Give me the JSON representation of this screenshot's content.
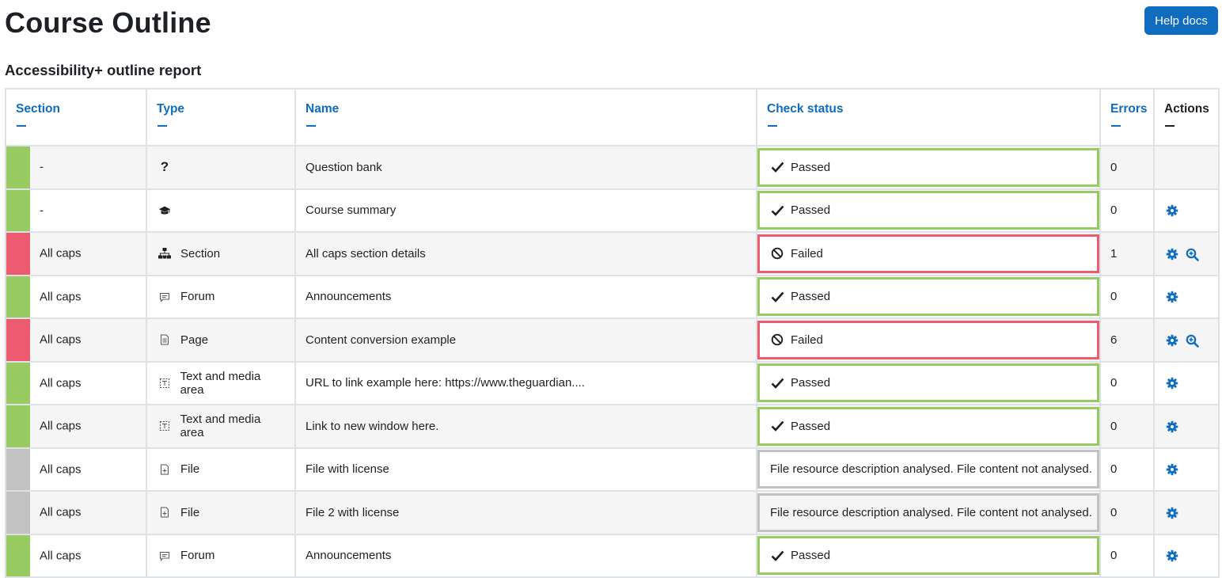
{
  "page": {
    "title": "Course Outline",
    "help_label": "Help docs"
  },
  "report": {
    "title": "Accessibility+ outline report"
  },
  "colors": {
    "accent": "#0f6cbf",
    "pass": "#98ca62",
    "fail": "#ec5b6f",
    "neutral": "#c2c2c2"
  },
  "table": {
    "headers": [
      "Section",
      "Type",
      "Name",
      "Check status",
      "Errors",
      "Actions"
    ],
    "rows": [
      {
        "status_kind": "pass",
        "section": "-",
        "type": "",
        "type_icon": "question-icon",
        "name": "Question bank",
        "status": "Passed",
        "errors": "0",
        "actions": []
      },
      {
        "status_kind": "pass",
        "section": "-",
        "type": "",
        "type_icon": "graduation-cap-icon",
        "name": "Course summary",
        "status": "Passed",
        "errors": "0",
        "actions": [
          "gear-icon"
        ]
      },
      {
        "status_kind": "fail",
        "section": "All caps",
        "type": "Section",
        "type_icon": "sitemap-icon",
        "name": "All caps section details",
        "status": "Failed",
        "errors": "1",
        "actions": [
          "gear-icon",
          "zoom-icon"
        ]
      },
      {
        "status_kind": "pass",
        "section": "All caps",
        "type": "Forum",
        "type_icon": "forum-icon",
        "name": "Announcements",
        "status": "Passed",
        "errors": "0",
        "actions": [
          "gear-icon"
        ]
      },
      {
        "status_kind": "fail",
        "section": "All caps",
        "type": "Page",
        "type_icon": "page-icon",
        "name": "Content conversion example",
        "status": "Failed",
        "errors": "6",
        "actions": [
          "gear-icon",
          "zoom-icon"
        ]
      },
      {
        "status_kind": "pass",
        "section": "All caps",
        "type": "Text and media area",
        "type_icon": "text-media-icon",
        "name": "URL to link example here: https://www.theguardian....",
        "status": "Passed",
        "errors": "0",
        "actions": [
          "gear-icon"
        ]
      },
      {
        "status_kind": "pass",
        "section": "All caps",
        "type": "Text and media area",
        "type_icon": "text-media-icon",
        "name": "Link to new window here.",
        "status": "Passed",
        "errors": "0",
        "actions": [
          "gear-icon"
        ]
      },
      {
        "status_kind": "neutral",
        "section": "All caps",
        "type": "File",
        "type_icon": "file-icon",
        "name": "File with license",
        "status": "File resource description analysed. File content not analysed.",
        "errors": "0",
        "actions": [
          "gear-icon"
        ]
      },
      {
        "status_kind": "neutral",
        "section": "All caps",
        "type": "File",
        "type_icon": "file-icon",
        "name": "File 2 with license",
        "status": "File resource description analysed. File content not analysed.",
        "errors": "0",
        "actions": [
          "gear-icon"
        ]
      },
      {
        "status_kind": "pass",
        "section": "All caps",
        "type": "Forum",
        "type_icon": "forum-icon",
        "name": "Announcements",
        "status": "Passed",
        "errors": "0",
        "actions": [
          "gear-icon"
        ]
      }
    ]
  }
}
